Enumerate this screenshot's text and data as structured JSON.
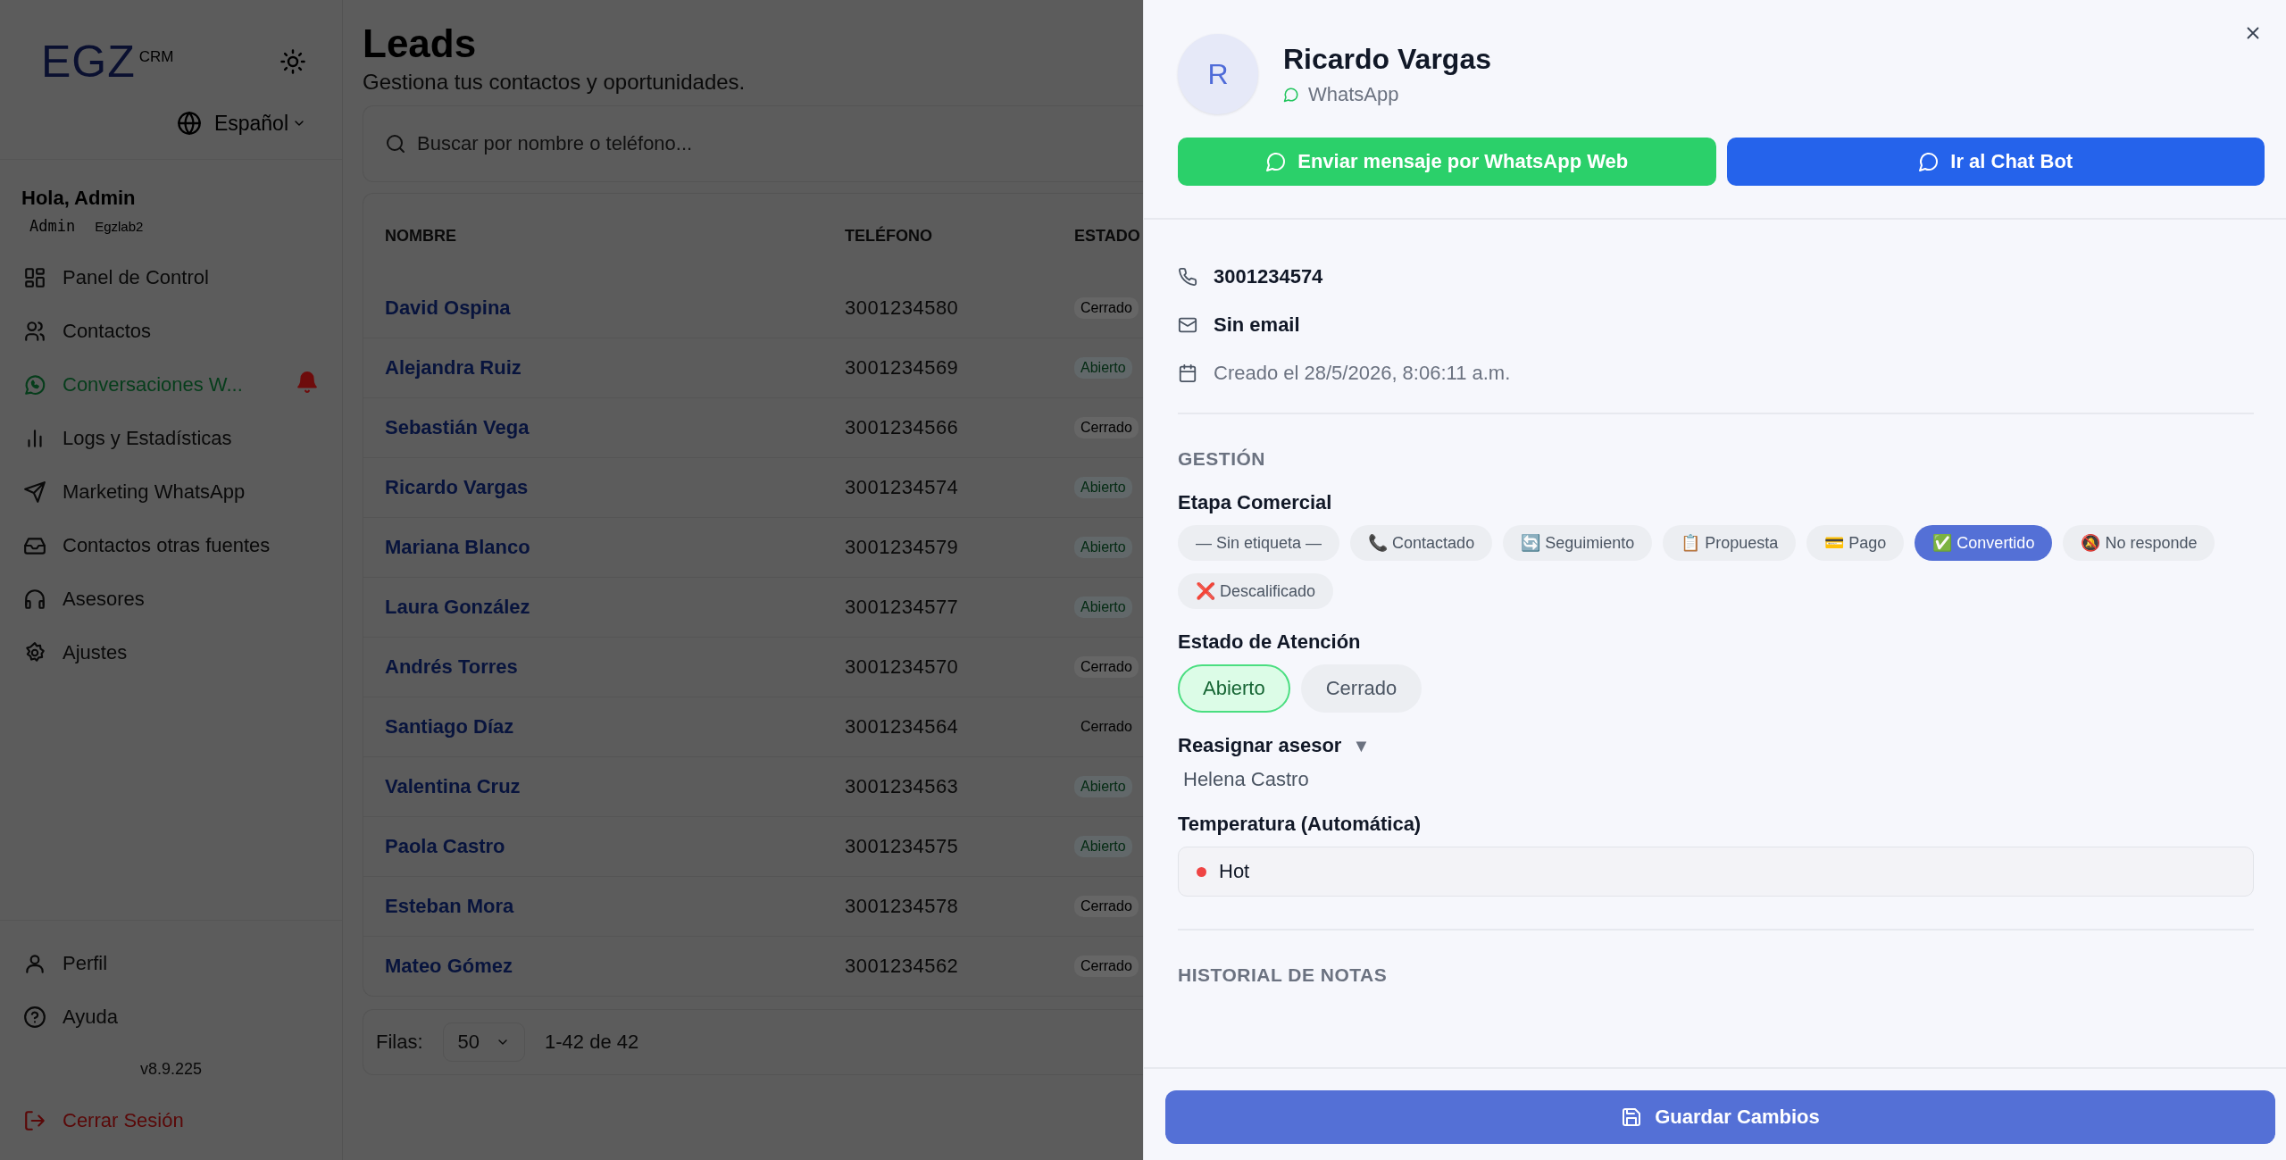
{
  "sidebar": {
    "logo": {
      "mark": "EGZ",
      "suffix": "CRM"
    },
    "language": "Español",
    "greeting": "Hola, Admin",
    "role": "Admin",
    "org": "Egzlab2",
    "items": [
      {
        "label": "Panel de Control",
        "selected": false,
        "alert": false
      },
      {
        "label": "Contactos",
        "selected": false,
        "alert": false
      },
      {
        "label": "Conversaciones W...",
        "selected": true,
        "alert": true
      },
      {
        "label": "Logs y Estadísticas",
        "selected": false,
        "alert": false
      },
      {
        "label": "Marketing WhatsApp",
        "selected": false,
        "alert": false
      },
      {
        "label": "Contactos otras fuentes",
        "selected": false,
        "alert": false
      },
      {
        "label": "Asesores",
        "selected": false,
        "alert": false
      },
      {
        "label": "Ajustes",
        "selected": false,
        "alert": false
      }
    ],
    "bottom_items": [
      {
        "label": "Perfil"
      },
      {
        "label": "Ayuda"
      }
    ],
    "version": "v8.9.225",
    "logout": "Cerrar Sesión"
  },
  "page": {
    "title": "Leads",
    "subtitle": "Gestiona tus contactos y oportunidades.",
    "search": {
      "placeholder": "Buscar por nombre o teléfono..."
    },
    "table": {
      "columns": [
        "NOMBRE",
        "TELÉFONO",
        "ESTADO"
      ],
      "rows": [
        {
          "name": "David Ospina",
          "phone": "3001234580",
          "status": "Cerrado",
          "kind": "closed"
        },
        {
          "name": "Alejandra Ruiz",
          "phone": "3001234569",
          "status": "Abierto",
          "kind": "open"
        },
        {
          "name": "Sebastián Vega",
          "phone": "3001234566",
          "status": "Cerrado",
          "kind": "closed"
        },
        {
          "name": "Ricardo Vargas",
          "phone": "3001234574",
          "status": "Abierto",
          "kind": "open"
        },
        {
          "name": "Mariana Blanco",
          "phone": "3001234579",
          "status": "Abierto",
          "kind": "open"
        },
        {
          "name": "Laura González",
          "phone": "3001234577",
          "status": "Abierto",
          "kind": "open"
        },
        {
          "name": "Andrés Torres",
          "phone": "3001234570",
          "status": "Cerrado",
          "kind": "closed"
        },
        {
          "name": "Santiago Díaz",
          "phone": "3001234564",
          "status": "Cerrado",
          "kind": "plain"
        },
        {
          "name": "Valentina Cruz",
          "phone": "3001234563",
          "status": "Abierto",
          "kind": "open"
        },
        {
          "name": "Paola Castro",
          "phone": "3001234575",
          "status": "Abierto",
          "kind": "open"
        },
        {
          "name": "Esteban Mora",
          "phone": "3001234578",
          "status": "Cerrado",
          "kind": "closed"
        },
        {
          "name": "Mateo Gómez",
          "phone": "3001234562",
          "status": "Cerrado",
          "kind": "closed"
        }
      ]
    },
    "pagination": {
      "label": "Filas:",
      "rows_per_page": "50",
      "range": "1-42 de 42"
    }
  },
  "drawer": {
    "avatar": "R",
    "name": "Ricardo Vargas",
    "channel": "WhatsApp",
    "actions": [
      {
        "label": "Enviar mensaje por WhatsApp Web",
        "kind": "whatsapp"
      },
      {
        "label": "Ir al Chat Bot",
        "kind": "bot"
      }
    ],
    "phone": "3001234574",
    "email": "Sin email",
    "created": "Creado el 28/5/2026, 8:06:11 a.m.",
    "management": {
      "title": "GESTIÓN",
      "stage_label": "Etapa Comercial",
      "stages": [
        {
          "label": "— Sin etiqueta —",
          "selected": false
        },
        {
          "label": "📞 Contactado",
          "selected": false
        },
        {
          "label": "🔄 Seguimiento",
          "selected": false
        },
        {
          "label": "📋 Propuesta",
          "selected": false
        },
        {
          "label": "💳 Pago",
          "selected": false
        },
        {
          "label": "✅ Convertido",
          "selected": true
        },
        {
          "label": "🔕 No responde",
          "selected": false
        },
        {
          "label": "❌ Descalificado",
          "selected": false
        }
      ],
      "attention_label": "Estado de Atención",
      "attention": [
        {
          "label": "Abierto",
          "selected": true
        },
        {
          "label": "Cerrado",
          "selected": false
        }
      ],
      "reassign_label": "Reasignar asesor",
      "reassign_marker": "▼",
      "advisor": "Helena Castro",
      "temperature_label": "Temperatura (Automática)",
      "temperature": {
        "value": "Hot",
        "color": "#ef4444"
      }
    },
    "notes_title": "HISTORIAL DE NOTAS",
    "save": "Guardar Cambios"
  }
}
